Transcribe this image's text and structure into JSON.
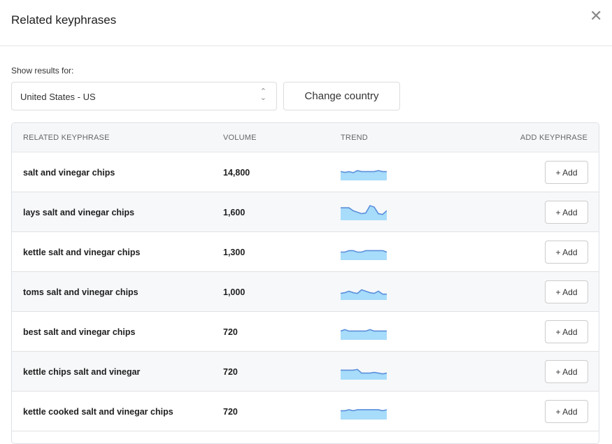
{
  "dialog": {
    "title": "Related keyphrases",
    "close_icon": "close-icon"
  },
  "filter": {
    "label": "Show results for:",
    "country_value": "United States - US",
    "change_button": "Change country"
  },
  "table": {
    "headers": [
      "RELATED KEYPHRASE",
      "VOLUME",
      "TREND",
      "ADD KEYPHRASE"
    ],
    "add_label": "+ Add",
    "trend_colors": {
      "line": "#5a8fdc",
      "fill": "#a7dcfa"
    },
    "rows": [
      {
        "keyphrase": "salt and vinegar chips",
        "volume": "14,800",
        "trend": [
          56,
          50,
          55,
          48,
          62,
          55,
          55,
          55,
          55,
          62,
          55,
          55
        ]
      },
      {
        "keyphrase": "lays salt and vinegar chips",
        "volume": "1,600",
        "trend": [
          80,
          80,
          80,
          60,
          50,
          40,
          45,
          95,
          85,
          40,
          35,
          60
        ]
      },
      {
        "keyphrase": "kettle salt and vinegar chips",
        "volume": "1,300",
        "trend": [
          50,
          50,
          60,
          60,
          50,
          50,
          60,
          60,
          60,
          60,
          60,
          50
        ]
      },
      {
        "keyphrase": "toms salt and vinegar chips",
        "volume": "1,000",
        "trend": [
          40,
          45,
          55,
          45,
          40,
          65,
          55,
          45,
          40,
          55,
          35,
          35
        ]
      },
      {
        "keyphrase": "best salt and vinegar chips",
        "volume": "720",
        "trend": [
          55,
          65,
          55,
          55,
          55,
          55,
          55,
          65,
          55,
          55,
          55,
          55
        ]
      },
      {
        "keyphrase": "kettle chips salt and vinegar",
        "volume": "720",
        "trend": [
          60,
          60,
          60,
          60,
          65,
          40,
          40,
          40,
          45,
          40,
          35,
          40
        ]
      },
      {
        "keyphrase": "kettle cooked salt and vinegar chips",
        "volume": "720",
        "trend": [
          55,
          55,
          62,
          55,
          62,
          62,
          62,
          62,
          62,
          62,
          55,
          62
        ]
      }
    ]
  }
}
